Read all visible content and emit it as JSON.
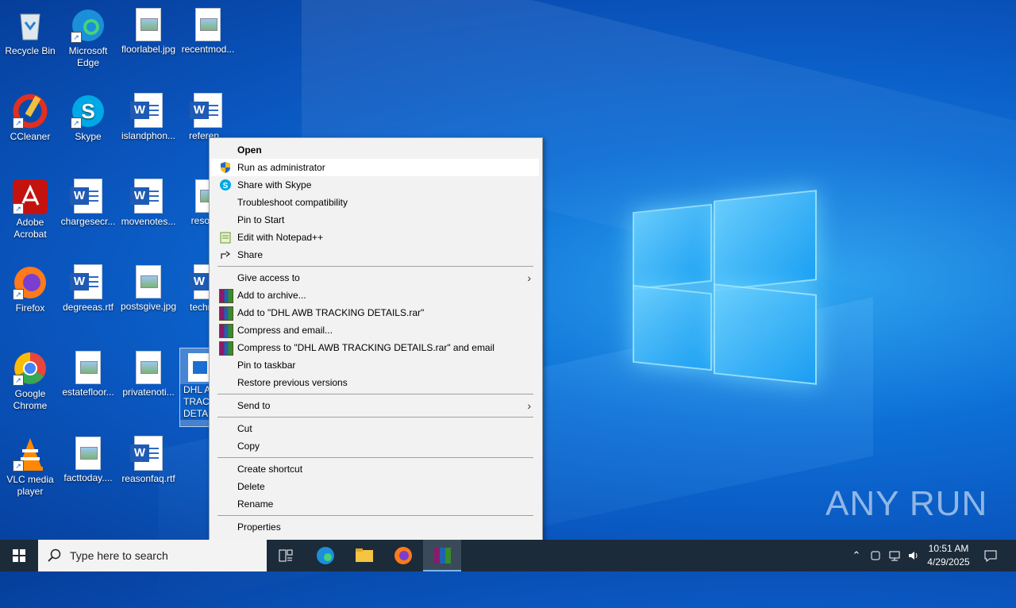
{
  "desktop": {
    "icons": [
      {
        "label": "Recycle Bin"
      },
      {
        "label": "Microsoft Edge"
      },
      {
        "label": "floorlabel.jpg"
      },
      {
        "label": "recentmod..."
      },
      {
        "label": "CCleaner"
      },
      {
        "label": "Skype"
      },
      {
        "label": "islandphon..."
      },
      {
        "label": "referen..."
      },
      {
        "label": "Adobe Acrobat"
      },
      {
        "label": "chargesecr..."
      },
      {
        "label": "movenotes..."
      },
      {
        "label": "resolu..."
      },
      {
        "label": "Firefox"
      },
      {
        "label": "degreeas.rtf"
      },
      {
        "label": "postsgive.jpg"
      },
      {
        "label": "techno..."
      },
      {
        "label": "Google Chrome"
      },
      {
        "label": "estatefloor..."
      },
      {
        "label": "privatenoti..."
      },
      {
        "label": "DHL A TRAC DETAIL"
      },
      {
        "label": "VLC media player"
      },
      {
        "label": "facttoday...."
      },
      {
        "label": "reasonfaq.rtf"
      }
    ]
  },
  "context_menu": {
    "items": [
      {
        "label": "Open"
      },
      {
        "label": "Run as administrator"
      },
      {
        "label": "Share with Skype"
      },
      {
        "label": "Troubleshoot compatibility"
      },
      {
        "label": "Pin to Start"
      },
      {
        "label": "Edit with Notepad++"
      },
      {
        "label": "Share"
      },
      {
        "label": "Give access to"
      },
      {
        "label": "Add to archive..."
      },
      {
        "label": "Add to \"DHL AWB TRACKING DETAILS.rar\""
      },
      {
        "label": "Compress and email..."
      },
      {
        "label": "Compress to \"DHL AWB TRACKING DETAILS.rar\" and email"
      },
      {
        "label": "Pin to taskbar"
      },
      {
        "label": "Restore previous versions"
      },
      {
        "label": "Send to"
      },
      {
        "label": "Cut"
      },
      {
        "label": "Copy"
      },
      {
        "label": "Create shortcut"
      },
      {
        "label": "Delete"
      },
      {
        "label": "Rename"
      },
      {
        "label": "Properties"
      }
    ]
  },
  "watermark": "ANY RUN",
  "taskbar": {
    "search_placeholder": "Type here to search",
    "time": "10:51 AM",
    "date": "4/29/2025"
  },
  "colors": {
    "accent": "#0a5fc8",
    "taskbar": "#1c2b3a",
    "menu_bg": "#f2f2f2"
  }
}
